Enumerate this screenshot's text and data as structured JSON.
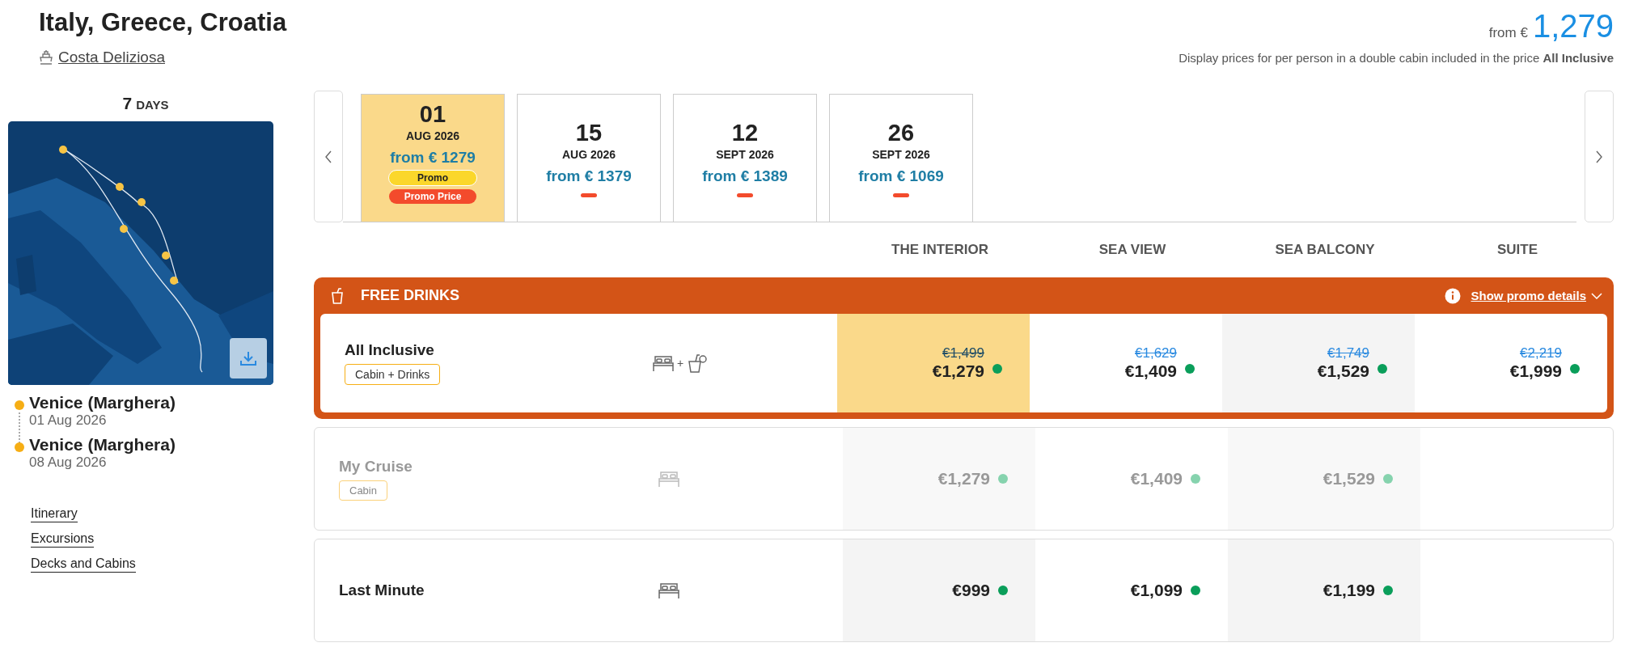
{
  "header": {
    "title": "Italy, Greece, Croatia",
    "ship": "Costa Deliziosa",
    "price_prefix": "from €",
    "price": "1,279",
    "note": "Display prices for per person in a double cabin included in the price **All Inclusive**"
  },
  "duration": {
    "number": "7",
    "unit": "DAYS"
  },
  "map": {
    "kind": "picture"
  },
  "route": [
    {
      "port": "Venice (Marghera)",
      "date": "01 Aug 2026"
    },
    {
      "port": "Venice (Marghera)",
      "date": "08 Aug 2026"
    }
  ],
  "links": [
    "Itinerary",
    "Excursions",
    "Decks and Cabins"
  ],
  "dates": [
    {
      "day": "01",
      "month": "AUG 2026",
      "price": "from € 1279",
      "selected": true,
      "marker": false,
      "badges": [
        {
          "text": "Promo",
          "kind": "promo"
        },
        {
          "text": "Promo Price",
          "kind": "price"
        }
      ]
    },
    {
      "day": "15",
      "month": "AUG 2026",
      "price": "from € 1379",
      "selected": false,
      "marker": true
    },
    {
      "day": "12",
      "month": "SEPT 2026",
      "price": "from € 1389",
      "selected": false,
      "marker": true
    },
    {
      "day": "26",
      "month": "SEPT 2026",
      "price": "from € 1069",
      "selected": false,
      "marker": true
    }
  ],
  "columns": [
    "THE INTERIOR",
    "SEA VIEW",
    "SEA BALCONY",
    "SUITE"
  ],
  "promo": {
    "title": "FREE DRINKS",
    "link": "Show promo details"
  },
  "fares": [
    {
      "name": "All Inclusive",
      "tag": "Cabin + Drinks",
      "extra": {
        "sign": "+"
      },
      "promo": true,
      "disabled": false,
      "prices": [
        {
          "old": "€1,499",
          "price": "€1,279",
          "selected": true
        },
        {
          "old": "€1,629",
          "price": "€1,409",
          "selected": false
        },
        {
          "old": "€1,749",
          "price": "€1,529",
          "selected": false
        },
        {
          "old": "€2,219",
          "price": "€1,999",
          "selected": false
        }
      ]
    },
    {
      "name": "My Cruise",
      "tag": "Cabin",
      "promo": false,
      "disabled": true,
      "prices": [
        {
          "price": "€1,279",
          "selected": false
        },
        {
          "price": "€1,409",
          "selected": false
        },
        {
          "price": "€1,529",
          "selected": false
        }
      ]
    },
    {
      "name": "Last Minute",
      "promo": false,
      "disabled": false,
      "prices": [
        {
          "price": "€999",
          "selected": false
        },
        {
          "price": "€1,099",
          "selected": false
        },
        {
          "price": "€1,199",
          "selected": false
        }
      ]
    }
  ]
}
